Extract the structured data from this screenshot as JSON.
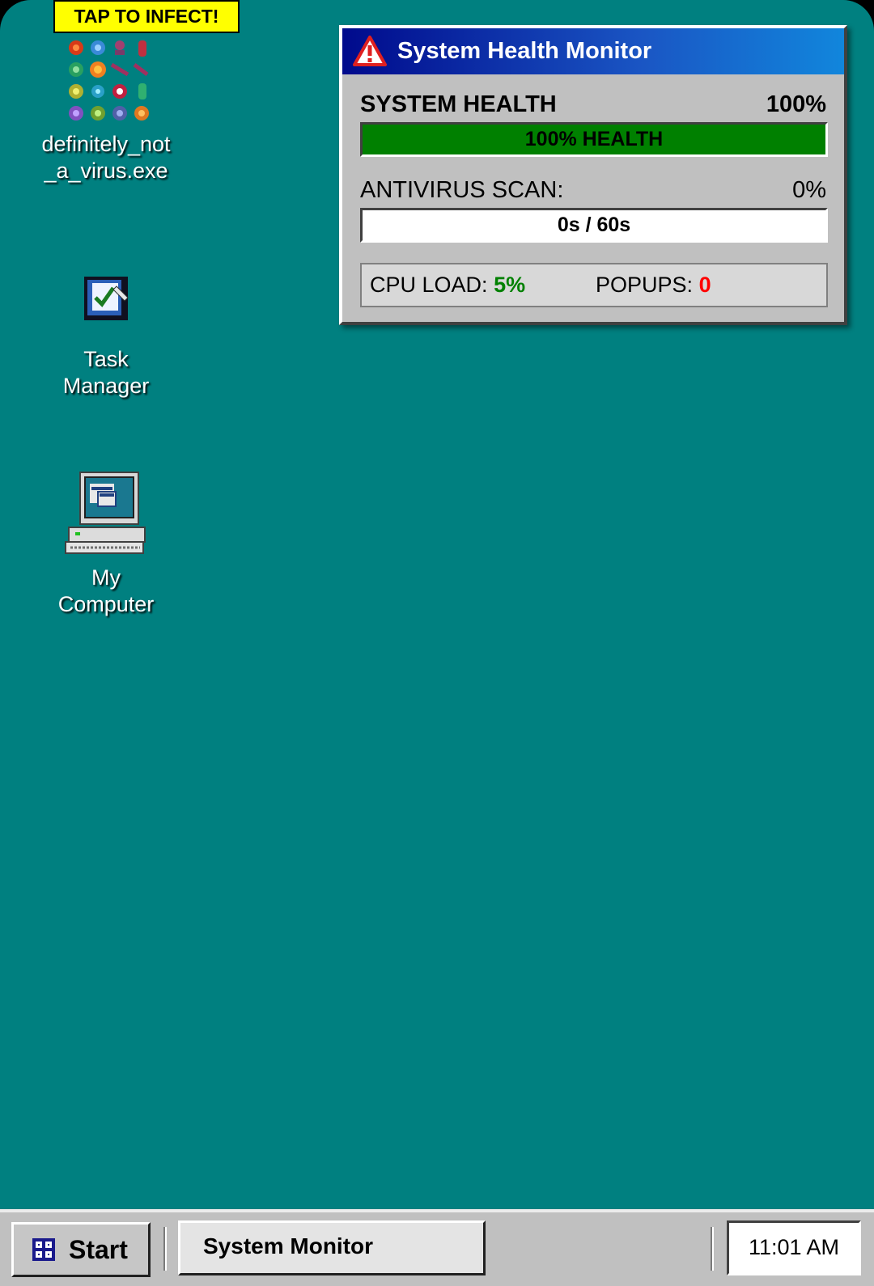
{
  "desktop": {
    "virus": {
      "badge": "TAP TO INFECT!",
      "label": "definitely_not_a_virus.exe",
      "label_line1": "definitely_not",
      "label_line2": "_a_virus.exe",
      "icon": "virus-cluster-icon"
    },
    "task_manager": {
      "label_line1": "Task",
      "label_line2": "Manager",
      "icon": "task-manager-icon"
    },
    "my_computer": {
      "label_line1": "My",
      "label_line2": "Computer",
      "icon": "computer-icon"
    },
    "background_color": "#008080"
  },
  "monitor": {
    "title": "System Health Monitor",
    "icon": "warning-icon",
    "health": {
      "label": "SYSTEM HEALTH",
      "value_text": "100%",
      "bar_text": "100% HEALTH",
      "level": 1.0,
      "color": "#008000"
    },
    "scan": {
      "label": "ANTIVIRUS SCAN:",
      "value_text": "0%",
      "bar_text": "0s / 60s",
      "level": 0.0
    },
    "stats": {
      "cpu_label": "CPU LOAD:",
      "cpu_value": "5%",
      "cpu_color": "#008000",
      "popups_label": "POPUPS:",
      "popups_value": "0",
      "popups_color": "#ff0000"
    }
  },
  "taskbar": {
    "start_label": "Start",
    "start_icon": "windows-grid-icon",
    "task_label": "System Monitor",
    "clock": "11:01 AM"
  }
}
